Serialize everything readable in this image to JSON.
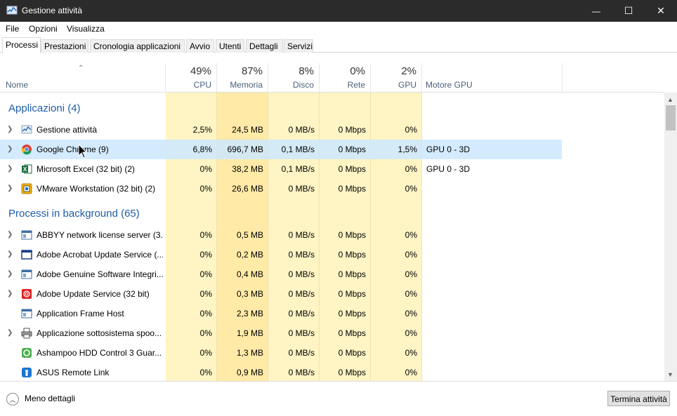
{
  "window": {
    "title": "Gestione attività",
    "minimize_glyph": "—",
    "maximize_glyph": "☐",
    "close_glyph": "✕"
  },
  "menu": [
    "File",
    "Opzioni",
    "Visualizza"
  ],
  "tabs": [
    "Processi",
    "Prestazioni",
    "Cronologia applicazioni",
    "Avvio",
    "Utenti",
    "Dettagli",
    "Servizi"
  ],
  "header": {
    "name": "Nome",
    "columns": [
      {
        "pct": "49%",
        "label": "CPU"
      },
      {
        "pct": "87%",
        "label": "Memoria"
      },
      {
        "pct": "8%",
        "label": "Disco"
      },
      {
        "pct": "0%",
        "label": "Rete"
      },
      {
        "pct": "2%",
        "label": "GPU"
      }
    ],
    "gpu_engine": "Motore GPU"
  },
  "groups": {
    "apps": "Applicazioni (4)",
    "background": "Processi in background (65)"
  },
  "apps": [
    {
      "name": "Gestione attività",
      "cpu": "2,5%",
      "mem": "24,5 MB",
      "disk": "0 MB/s",
      "net": "0 Mbps",
      "gpu": "0%",
      "engine": "",
      "icon": "task-manager-icon"
    },
    {
      "name": "Google Chrome (9)",
      "cpu": "6,8%",
      "mem": "696,7 MB",
      "disk": "0,1 MB/s",
      "net": "0 Mbps",
      "gpu": "1,5%",
      "engine": "GPU 0 - 3D",
      "icon": "chrome-icon"
    },
    {
      "name": "Microsoft Excel (32 bit) (2)",
      "cpu": "0%",
      "mem": "38,2 MB",
      "disk": "0,1 MB/s",
      "net": "0 Mbps",
      "gpu": "0%",
      "engine": "GPU 0 - 3D",
      "icon": "excel-icon"
    },
    {
      "name": "VMware Workstation (32 bit) (2)",
      "cpu": "0%",
      "mem": "26,6 MB",
      "disk": "0 MB/s",
      "net": "0 Mbps",
      "gpu": "0%",
      "engine": "",
      "icon": "vmware-icon"
    }
  ],
  "background": [
    {
      "name": "ABBYY network license server (3...",
      "cpu": "0%",
      "mem": "0,5 MB",
      "disk": "0 MB/s",
      "net": "0 Mbps",
      "gpu": "0%",
      "icon": "service-window-icon"
    },
    {
      "name": "Adobe Acrobat Update Service (...",
      "cpu": "0%",
      "mem": "0,2 MB",
      "disk": "0 MB/s",
      "net": "0 Mbps",
      "gpu": "0%",
      "icon": "blue-window-icon"
    },
    {
      "name": "Adobe Genuine Software Integri...",
      "cpu": "0%",
      "mem": "0,4 MB",
      "disk": "0 MB/s",
      "net": "0 Mbps",
      "gpu": "0%",
      "icon": "service-window-icon"
    },
    {
      "name": "Adobe Update Service (32 bit)",
      "cpu": "0%",
      "mem": "0,3 MB",
      "disk": "0 MB/s",
      "net": "0 Mbps",
      "gpu": "0%",
      "icon": "adobe-icon"
    },
    {
      "name": "Application Frame Host",
      "cpu": "0%",
      "mem": "2,3 MB",
      "disk": "0 MB/s",
      "net": "0 Mbps",
      "gpu": "0%",
      "icon": "service-window-icon"
    },
    {
      "name": "Applicazione sottosistema spoo...",
      "cpu": "0%",
      "mem": "1,9 MB",
      "disk": "0 MB/s",
      "net": "0 Mbps",
      "gpu": "0%",
      "icon": "printer-icon"
    },
    {
      "name": "Ashampoo HDD Control 3 Guar...",
      "cpu": "0%",
      "mem": "1,3 MB",
      "disk": "0 MB/s",
      "net": "0 Mbps",
      "gpu": "0%",
      "icon": "ashampoo-icon"
    },
    {
      "name": "ASUS Remote Link",
      "cpu": "0%",
      "mem": "0,9 MB",
      "disk": "0 MB/s",
      "net": "0 Mbps",
      "gpu": "0%",
      "icon": "asus-icon"
    }
  ],
  "footer": {
    "less_details": "Meno dettagli",
    "end_task": "Termina attività"
  }
}
